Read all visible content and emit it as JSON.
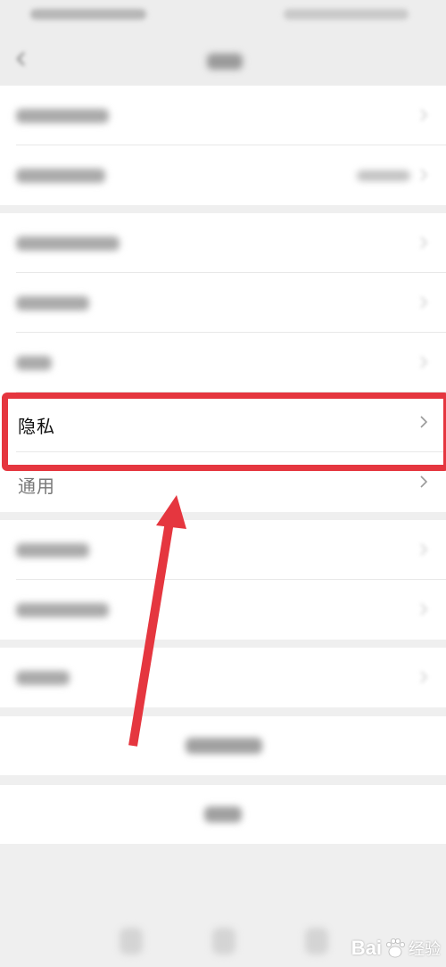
{
  "highlighted_item": {
    "label": "隐私",
    "chevron": ">"
  },
  "next_item": {
    "label": "通用",
    "chevron": ">"
  },
  "watermark": {
    "text": "Bai",
    "suffix": "经验",
    "icon": "baidu-paw-icon"
  },
  "annotation": {
    "color": "#e5363f",
    "shape": "rounded-rectangle + arrow"
  }
}
